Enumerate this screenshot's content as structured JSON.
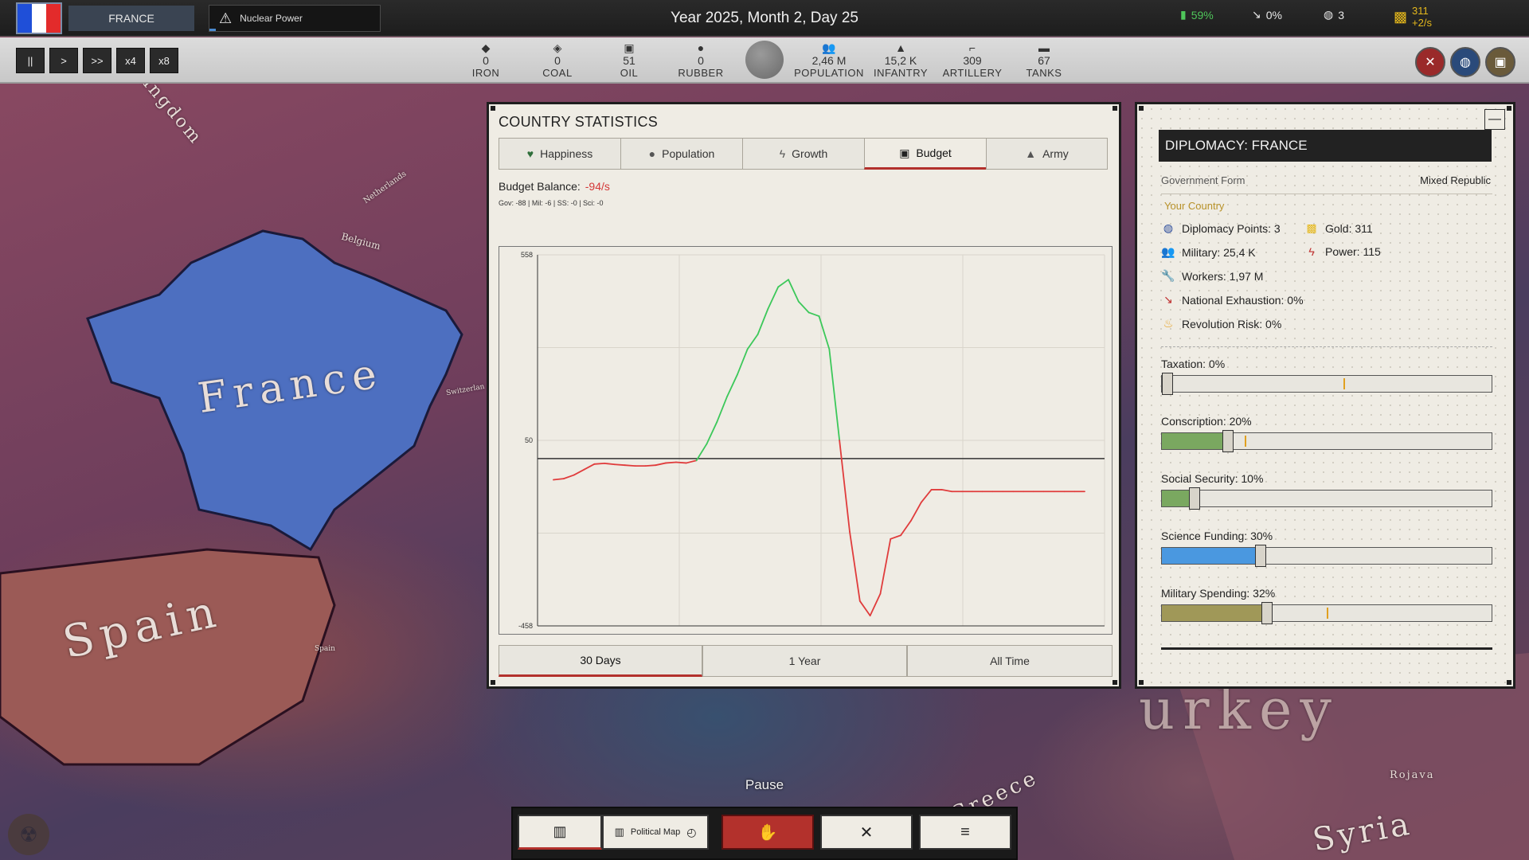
{
  "top": {
    "country": "FRANCE",
    "nuclear_label": "Nuclear Power",
    "date": "Year 2025, Month 2, Day 25",
    "approval": "59%",
    "exhaustion": "0%",
    "diplomacy_points": "3",
    "gold": "311",
    "gold_rate": "+2/s"
  },
  "speed": {
    "pause": "||",
    "play": ">",
    "fast": ">>",
    "x4": "x4",
    "x8": "x8"
  },
  "resources": [
    {
      "value": "0",
      "label": "IRON",
      "icon": "iron-icon"
    },
    {
      "value": "0",
      "label": "COAL",
      "icon": "coal-icon"
    },
    {
      "value": "51",
      "label": "OIL",
      "icon": "oil-icon"
    },
    {
      "value": "0",
      "label": "RUBBER",
      "icon": "rubber-icon"
    },
    {
      "value": "2,46 M",
      "label": "POPULATION",
      "icon": "population-icon"
    },
    {
      "value": "15,2 K",
      "label": "INFANTRY",
      "icon": "infantry-icon"
    },
    {
      "value": "309",
      "label": "ARTILLERY",
      "icon": "artillery-icon"
    },
    {
      "value": "67",
      "label": "TANKS",
      "icon": "tanks-icon"
    }
  ],
  "map_labels": {
    "france": "France",
    "spain": "Spain",
    "kingdom": "Kingdom",
    "belgium": "Belgium",
    "netherlands": "Netherlands",
    "switzerland": "Switzerlan",
    "syria": "Syria",
    "greece": "Greece",
    "rojava": "Rojava",
    "turkey": "urkey",
    "spain_small": "Spain"
  },
  "stats": {
    "title": "COUNTRY STATISTICS",
    "tabs": [
      "Happiness",
      "Population",
      "Growth",
      "Budget",
      "Army"
    ],
    "active_tab": "Budget",
    "balance_label": "Budget Balance:",
    "balance_value": "-94/s",
    "balance_breakdown": "Gov: -88  |  Mil: -6  |  SS: -0  |  Sci: -0",
    "ranges": [
      "30 Days",
      "1 Year",
      "All Time"
    ],
    "active_range": "30 Days"
  },
  "chart_data": {
    "type": "line",
    "title": "",
    "xlabel": "",
    "ylabel": "",
    "y_ticks": [
      "558",
      "50",
      "-458"
    ],
    "ylim": [
      -458,
      558
    ],
    "zero_line": 0,
    "grid": true,
    "positive_color": "#3cc85a",
    "negative_color": "#e03c3c",
    "series": [
      {
        "values": [
          -58,
          -55,
          -45,
          -30,
          -15,
          -13,
          -16,
          -18,
          -20,
          -20,
          -18,
          -12,
          -10,
          -12,
          -5,
          40,
          100,
          170,
          230,
          300,
          340,
          410,
          470,
          490,
          430,
          400,
          390,
          300,
          50,
          -200,
          -390,
          -430,
          -370,
          -220,
          -210,
          -170,
          -120,
          -85,
          -85,
          -90,
          -90,
          -90,
          -90,
          -90,
          -90,
          -90,
          -90,
          -90,
          -90,
          -90,
          -90,
          -90,
          -90
        ]
      }
    ]
  },
  "diplomacy": {
    "title": "DIPLOMACY: FRANCE",
    "gov_label": "Government Form",
    "gov_value": "Mixed Republic",
    "your_country": "Your Country",
    "diplomacy_points": "Diplomacy Points: 3",
    "gold": "Gold: 311",
    "military": "Military: 25,4 K",
    "power": "Power: 115",
    "workers": "Workers: 1,97 M",
    "exhaustion": "National Exhaustion: 0%",
    "revolution": "Revolution Risk: 0%",
    "sliders": [
      {
        "label": "Taxation: 0%",
        "value": 0,
        "color": "#7aa860",
        "mark": 0.55
      },
      {
        "label": "Conscription: 20%",
        "value": 0.2,
        "color": "#7aa860",
        "mark": 0.25
      },
      {
        "label": "Social Security: 10%",
        "value": 0.1,
        "color": "#7aa860",
        "mark": null
      },
      {
        "label": "Science Funding: 30%",
        "value": 0.3,
        "color": "#4a98e0",
        "mark": null
      },
      {
        "label": "Military Spending: 32%",
        "value": 0.32,
        "color": "#a09858",
        "mark": 0.5
      }
    ]
  },
  "bottom": {
    "pause_label": "Pause",
    "political_map": "Political Map"
  },
  "colors": {
    "accent_red": "#b3312c",
    "flag_blue": "#1f4fd8",
    "flag_white": "#ffffff",
    "flag_red": "#e32b2b",
    "gold": "#e5b81c",
    "approval_green": "#4fc55a"
  }
}
